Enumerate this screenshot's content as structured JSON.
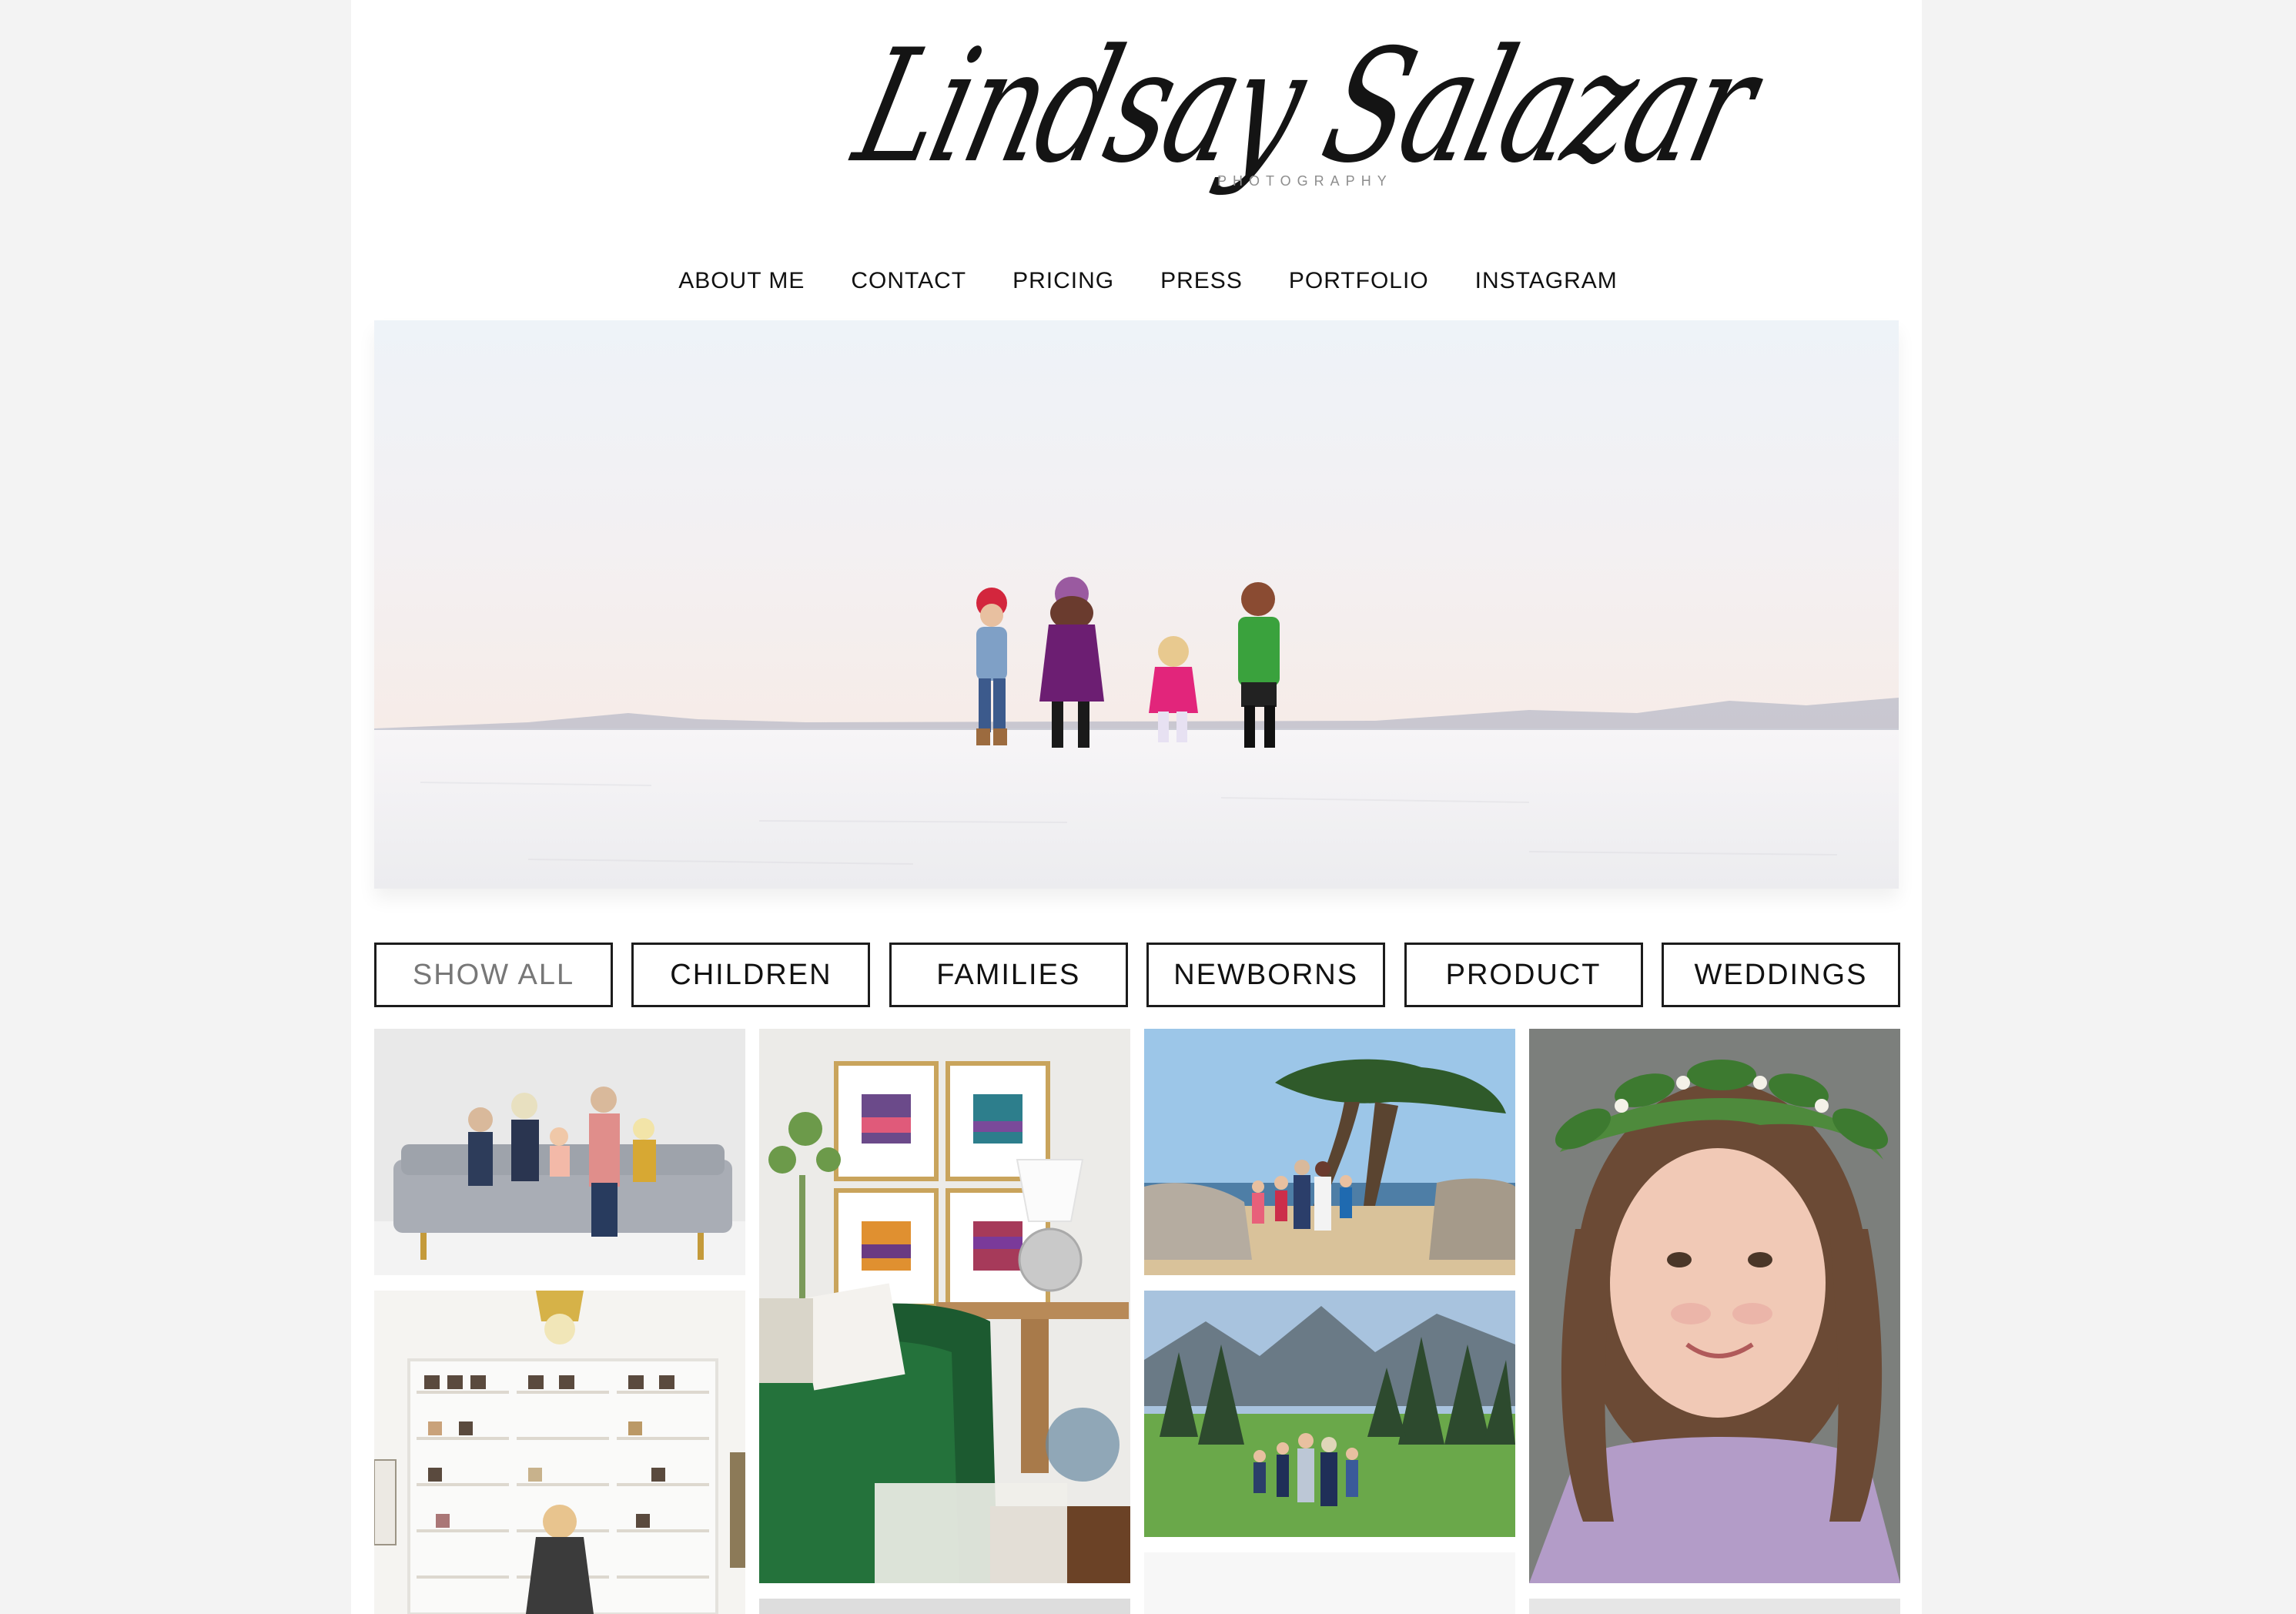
{
  "header": {
    "logo_text": "Lindsay Salazar",
    "logo_subtext": "PHOTOGRAPHY"
  },
  "nav": {
    "items": [
      "ABOUT ME",
      "CONTACT",
      "PRICING",
      "PRESS",
      "PORTFOLIO",
      "INSTAGRAM"
    ]
  },
  "filters": {
    "items": [
      "SHOW ALL",
      "CHILDREN",
      "FAMILIES",
      "NEWBORNS",
      "PRODUCT",
      "WEDDINGS"
    ],
    "active": "SHOW ALL"
  },
  "colors": {
    "text": "#111111",
    "page_background": "#f3f3f3",
    "content_background": "#ffffff",
    "inactive_filter_text": "#777777"
  }
}
